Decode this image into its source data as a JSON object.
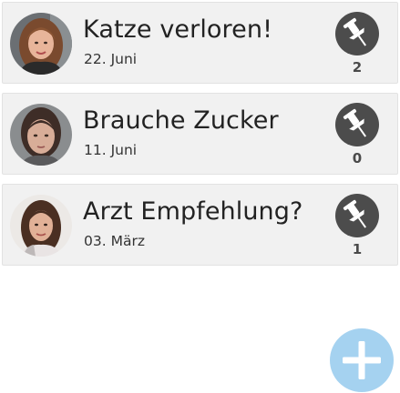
{
  "posts": [
    {
      "title": "Katze verloren!",
      "date": "22. Juni",
      "count": "2",
      "avatar": "woman-avatar-1"
    },
    {
      "title": "Brauche Zucker",
      "date": "11. Juni",
      "count": "0",
      "avatar": "woman-avatar-2"
    },
    {
      "title": "Arzt Empfehlung?",
      "date": "03. März",
      "count": "1",
      "avatar": "woman-avatar-3"
    }
  ],
  "icons": {
    "pin": "pushpin-icon",
    "add": "plus-icon"
  },
  "colors": {
    "card_background": "#f1f1f1",
    "pin_button": "#4c4c4c",
    "fab": "#a5d2f0"
  }
}
